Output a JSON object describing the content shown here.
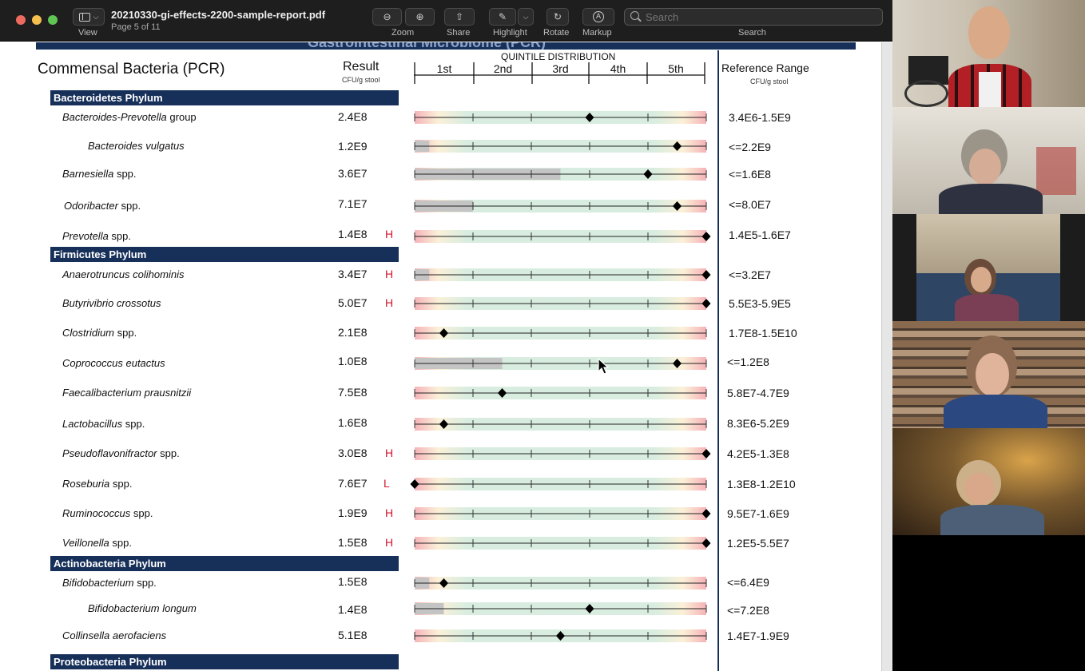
{
  "window": {
    "title": "20210330-gi-effects-2200-sample-report.pdf",
    "page_indicator": "Page 5 of 11",
    "toolbar": {
      "view_label": "View",
      "zoom_label": "Zoom",
      "share_label": "Share",
      "highlight_label": "Highlight",
      "rotate_label": "Rotate",
      "markup_label": "Markup",
      "search_label": "Search",
      "search_placeholder": "Search"
    }
  },
  "report": {
    "banner_text": "Gastrointestinal Microbiome (PCR)",
    "section_title": "Commensal Bacteria (PCR)",
    "result_header": "Result",
    "result_unit": "CFU/g stool",
    "quintile_header": "QUINTILE DISTRIBUTION",
    "quintiles": [
      "1st",
      "2nd",
      "3rd",
      "4th",
      "5th"
    ],
    "reference_header": "Reference Range",
    "reference_unit": "CFU/g stool",
    "phyla": [
      "Bacteroidetes Phylum",
      "Firmicutes Phylum",
      "Actinobacteria Phylum",
      "Proteobacteria Phylum"
    ],
    "rows": [
      {
        "name": "Bacteroides-Prevotella",
        "suffix": " group",
        "value": "2.4E8",
        "flag": "",
        "reference": "3.4E6-1.5E9",
        "marker_position": 0.6,
        "gray_fill": 0
      },
      {
        "name": "Bacteroides vulgatus",
        "suffix": "",
        "value": "1.2E9",
        "flag": "",
        "reference": "<=2.2E9",
        "marker_position": 0.9,
        "gray_fill": 0.05
      },
      {
        "name": "Barnesiella",
        "suffix": " spp.",
        "value": "3.6E7",
        "flag": "",
        "reference": "<=1.6E8",
        "marker_position": 0.8,
        "gray_fill": 0.5
      },
      {
        "name": "Odoribacter",
        "suffix": " spp.",
        "value": "7.1E7",
        "flag": "",
        "reference": "<=8.0E7",
        "marker_position": 0.9,
        "gray_fill": 0.2
      },
      {
        "name": "Prevotella",
        "suffix": " spp.",
        "value": "1.4E8",
        "flag": "H",
        "reference": "1.4E5-1.6E7",
        "marker_position": 1.0,
        "gray_fill": 0
      },
      {
        "name": "Anaerotruncus colihominis",
        "suffix": "",
        "value": "3.4E7",
        "flag": "H",
        "reference": "<=3.2E7",
        "marker_position": 1.0,
        "gray_fill": 0.05
      },
      {
        "name": "Butyrivibrio crossotus",
        "suffix": "",
        "value": "5.0E7",
        "flag": "H",
        "reference": "5.5E3-5.9E5",
        "marker_position": 1.0,
        "gray_fill": 0
      },
      {
        "name": "Clostridium",
        "suffix": " spp.",
        "value": "2.1E8",
        "flag": "",
        "reference": "1.7E8-1.5E10",
        "marker_position": 0.1,
        "gray_fill": 0
      },
      {
        "name": "Coprococcus eutactus",
        "suffix": "",
        "value": "1.0E8",
        "flag": "",
        "reference": "<=1.2E8",
        "marker_position": 0.9,
        "gray_fill": 0.3
      },
      {
        "name": "Faecalibacterium prausnitzii",
        "suffix": "",
        "value": "7.5E8",
        "flag": "",
        "reference": "5.8E7-4.7E9",
        "marker_position": 0.3,
        "gray_fill": 0
      },
      {
        "name": "Lactobacillus",
        "suffix": " spp.",
        "value": "1.6E8",
        "flag": "",
        "reference": "8.3E6-5.2E9",
        "marker_position": 0.1,
        "gray_fill": 0
      },
      {
        "name": "Pseudoflavonifractor",
        "suffix": " spp.",
        "value": "3.0E8",
        "flag": "H",
        "reference": "4.2E5-1.3E8",
        "marker_position": 1.0,
        "gray_fill": 0
      },
      {
        "name": "Roseburia",
        "suffix": " spp.",
        "value": "7.6E7",
        "flag": "L",
        "reference": "1.3E8-1.2E10",
        "marker_position": 0.0,
        "gray_fill": 0
      },
      {
        "name": "Ruminococcus",
        "suffix": " spp.",
        "value": "1.9E9",
        "flag": "H",
        "reference": "9.5E7-1.6E9",
        "marker_position": 1.0,
        "gray_fill": 0
      },
      {
        "name": "Veillonella",
        "suffix": " spp.",
        "value": "1.5E8",
        "flag": "H",
        "reference": "1.2E5-5.5E7",
        "marker_position": 1.0,
        "gray_fill": 0
      },
      {
        "name": "Bifidobacterium",
        "suffix": " spp.",
        "value": "1.5E8",
        "flag": "",
        "reference": "<=6.4E9",
        "marker_position": 0.1,
        "gray_fill": 0.05
      },
      {
        "name": "Bifidobacterium longum",
        "suffix": "",
        "value": "1.4E8",
        "flag": "",
        "reference": "<=7.2E8",
        "marker_position": 0.6,
        "gray_fill": 0.1
      },
      {
        "name": "Collinsella aerofaciens",
        "suffix": "",
        "value": "5.1E8",
        "flag": "",
        "reference": "1.4E7-1.9E9",
        "marker_position": 0.5,
        "gray_fill": 0
      }
    ]
  },
  "colors": {
    "navy": "#17305a",
    "flag_red": "#d0142c",
    "range_green": "#d8ede0",
    "range_red": "#f5b3b8",
    "gray_fill": "#c4c4c4"
  },
  "video_participants": [
    {
      "name": "participant-1"
    },
    {
      "name": "participant-2"
    },
    {
      "name": "participant-3"
    },
    {
      "name": "participant-4"
    },
    {
      "name": "participant-5"
    }
  ]
}
